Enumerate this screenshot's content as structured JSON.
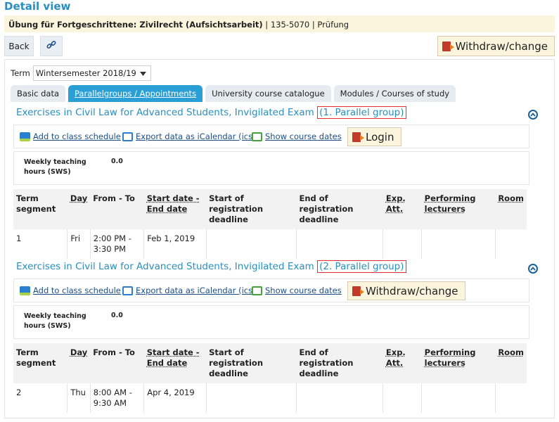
{
  "page_title": "Detail view",
  "course": {
    "title": "Übung für Fortgeschrittene: Zivilrecht (Aufsichtsarbeit)",
    "meta": " | 135-5070 | Prüfung"
  },
  "toolbar": {
    "back_label": "Back",
    "withdraw_label": "Withdraw/change"
  },
  "term": {
    "label": "Term",
    "selected": "Wintersemester 2018/19"
  },
  "tabs": [
    {
      "label": "Basic data"
    },
    {
      "label": "Parallelgroups / Appointments"
    },
    {
      "label": "University course catalogue"
    },
    {
      "label": "Modules / Courses of study"
    }
  ],
  "sections": [
    {
      "title": "Exercises in Civil Law for Advanced Students, Invigilated Exam",
      "group": "(1. Parallel group)",
      "action_label": "Login",
      "row": {
        "segment": "1",
        "day": "Fri",
        "from_to": "2:00 PM - 3:30 PM",
        "start_end": "Feb 1, 2019",
        "reg_start": "",
        "reg_end": "",
        "exp_att": "",
        "lecturers": "",
        "room": ""
      }
    },
    {
      "title": "Exercises in Civil Law for Advanced Students, Invigilated Exam",
      "group": "(2. Parallel group)",
      "action_label": "Withdraw/change",
      "row": {
        "segment": "2",
        "day": "Thu",
        "from_to": "8:00 AM - 9:30 AM",
        "start_end": "Apr 4, 2019",
        "reg_start": "",
        "reg_end": "",
        "exp_att": "",
        "lecturers": "",
        "room": ""
      }
    }
  ],
  "actions": {
    "add_schedule": "Add to class schedule",
    "export_ical": "Export data as iCalendar (ics)",
    "show_dates": "Show course dates"
  },
  "sws": {
    "label": "Weekly teaching hours (SWS)",
    "value": "0.0"
  },
  "table_headers": {
    "segment": "Term segment",
    "day": "Day",
    "from_to": "From - To",
    "start_end": "Start date - End date",
    "reg_start": "Start of registration deadline",
    "reg_end": "End of registration deadline",
    "exp_att": "Exp. Att.",
    "lecturers": "Performing lecturers",
    "room": "Room"
  },
  "colors": {
    "accent": "#2a9fd5",
    "title": "#2a8fc0",
    "highlight_border": "#e03030",
    "yellow_bg": "#fbf5dd"
  }
}
